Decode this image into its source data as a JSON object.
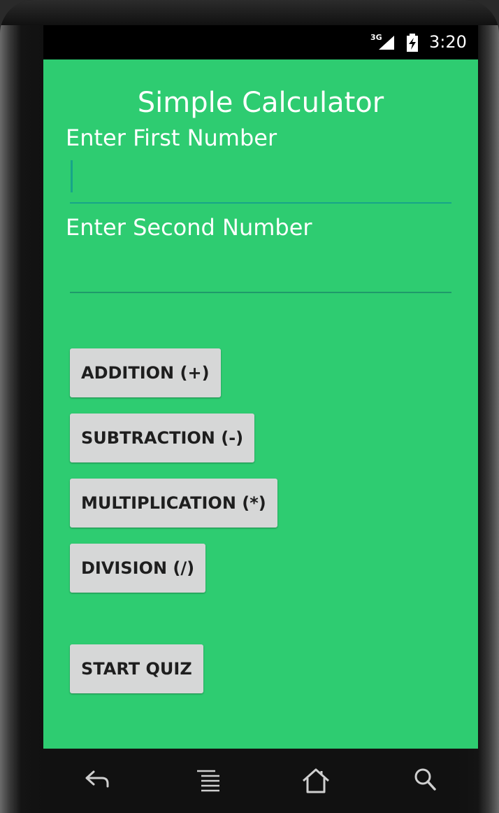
{
  "status_bar": {
    "network": "3G",
    "time": "3:20",
    "signal_icon": "signal-bars-icon",
    "battery_icon": "battery-charging-icon"
  },
  "app": {
    "title": "Simple Calculator",
    "accent_color": "#2ecc71"
  },
  "form": {
    "first_label": "Enter First Number",
    "first_value": "",
    "second_label": "Enter Second Number",
    "second_value": ""
  },
  "buttons": {
    "addition": "ADDITION (+)",
    "subtraction": "SUBTRACTION (-)",
    "multiplication": "MULTIPLICATION (*)",
    "division": "DIVISION (/)",
    "start_quiz": "START QUIZ"
  },
  "nav_bar": {
    "icons": [
      "back-icon",
      "menu-icon",
      "home-icon",
      "search-icon"
    ]
  }
}
